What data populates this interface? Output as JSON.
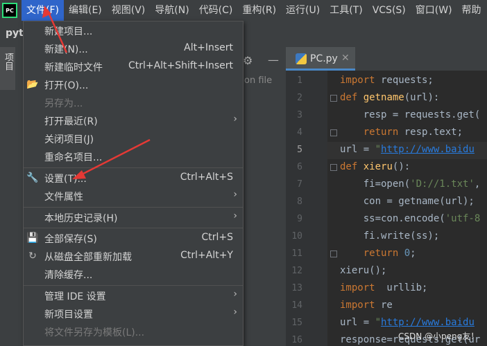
{
  "menubar": {
    "items": [
      "文件(F)",
      "编辑(E)",
      "视图(V)",
      "导航(N)",
      "代码(C)",
      "重构(R)",
      "运行(U)",
      "工具(T)",
      "VCS(S)",
      "窗口(W)",
      "帮助"
    ],
    "logo_text": "PC"
  },
  "toolbar": {
    "project_crumb": "pyt"
  },
  "left_stripe": {
    "label": "项目"
  },
  "project_panel": {
    "hint": "on file"
  },
  "editor": {
    "tab_label": "PC.py",
    "line_numbers": [
      "1",
      "2",
      "3",
      "4",
      "5",
      "6",
      "7",
      "8",
      "9",
      "10",
      "11",
      "12",
      "13",
      "14",
      "15",
      "16"
    ],
    "current_line": "5",
    "lines": [
      "import requests;",
      "def getname(url):",
      "    resp = requests.get(",
      "    return resp.text;",
      "url = \"http://www.baidu",
      "def xieru():",
      "    fi=open('D://1.txt',",
      "    con = getname(url);",
      "    ss=con.encode('utf-8",
      "    fi.write(ss);",
      "    return 0;",
      "xieru();",
      "import  urllib;",
      "import re",
      "url = \"http://www.baidu",
      "response=requests.get(ur"
    ]
  },
  "file_menu": {
    "items": [
      {
        "label": "新建项目...",
        "shortcut": ""
      },
      {
        "label": "新建(N)...",
        "shortcut": "Alt+Insert"
      },
      {
        "label": "新建临时文件",
        "shortcut": "Ctrl+Alt+Shift+Insert"
      },
      {
        "label": "打开(O)...",
        "shortcut": ""
      },
      {
        "label": "另存为...",
        "shortcut": ""
      },
      {
        "label": "打开最近(R)",
        "shortcut": ""
      },
      {
        "label": "关闭项目(J)",
        "shortcut": ""
      },
      {
        "label": "重命名项目...",
        "shortcut": ""
      },
      {
        "label": "设置(T)...",
        "shortcut": "Ctrl+Alt+S"
      },
      {
        "label": "文件属性",
        "shortcut": ""
      },
      {
        "label": "本地历史记录(H)",
        "shortcut": ""
      },
      {
        "label": "全部保存(S)",
        "shortcut": "Ctrl+S"
      },
      {
        "label": "从磁盘全部重新加载",
        "shortcut": "Ctrl+Alt+Y"
      },
      {
        "label": "清除缓存...",
        "shortcut": ""
      },
      {
        "label": "管理 IDE 设置",
        "shortcut": ""
      },
      {
        "label": "新项目设置",
        "shortcut": ""
      },
      {
        "label": "将文件另存为模板(L)...",
        "shortcut": ""
      }
    ]
  },
  "watermark": "CSDN @小peng友！",
  "colors": {
    "accent": "#2f65ca",
    "annotation": "#e53935"
  }
}
